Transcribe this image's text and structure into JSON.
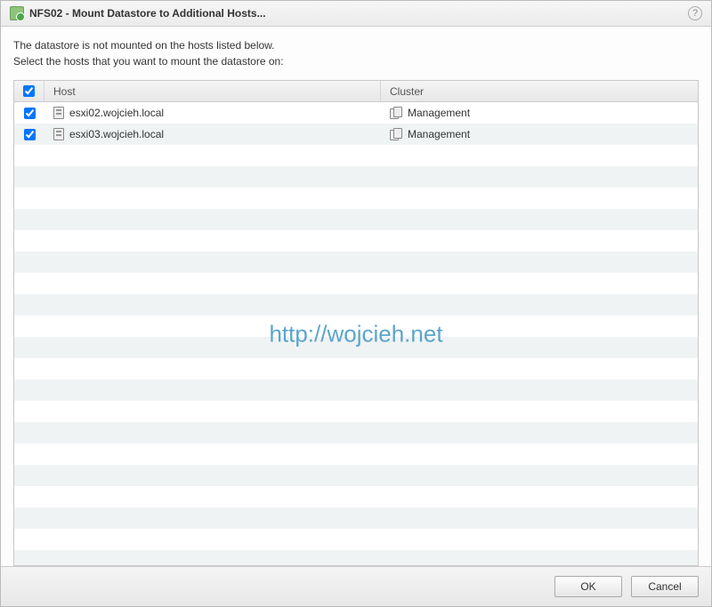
{
  "window": {
    "title": "NFS02 - Mount Datastore to Additional Hosts..."
  },
  "instructions": {
    "line1": "The datastore is not mounted on the hosts listed below.",
    "line2": "Select the hosts that you want to mount the datastore on:"
  },
  "table": {
    "headers": {
      "host": "Host",
      "cluster": "Cluster"
    },
    "selectAllChecked": true,
    "rows": [
      {
        "checked": true,
        "host": "esxi02.wojcieh.local",
        "cluster": "Management"
      },
      {
        "checked": true,
        "host": "esxi03.wojcieh.local",
        "cluster": "Management"
      }
    ],
    "emptyRowCount": 20
  },
  "watermark": "http://wojcieh.net",
  "footer": {
    "ok": "OK",
    "cancel": "Cancel"
  }
}
